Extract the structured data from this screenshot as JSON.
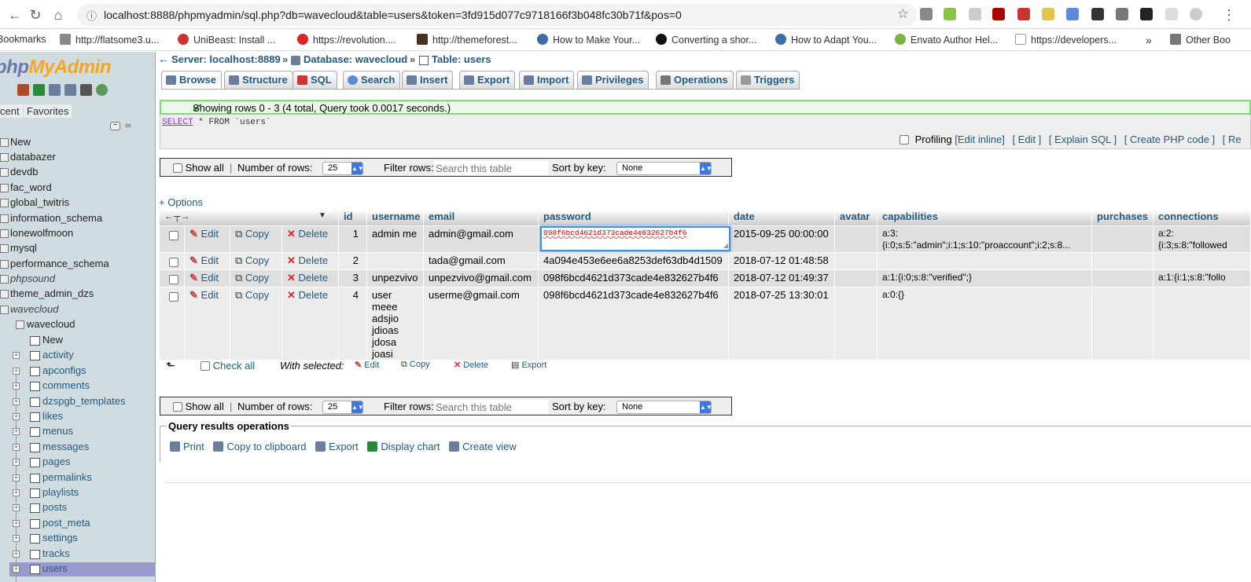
{
  "browser": {
    "url": "localhost:8888/phpmyadmin/sql.php?db=wavecloud&table=users&token=3fd915d077c9718166f3b048fc30b71f&pos=0",
    "bookmarks": [
      "Bookmarks",
      "http://flatsome3.u...",
      "UniBeast: Install ...",
      "https://revolution....",
      "http://themeforest...",
      "How to Make Your...",
      "Converting a shor...",
      "How to Adapt You...",
      "Envato Author Hel...",
      "https://developers...",
      "Other Boo"
    ],
    "more": "»"
  },
  "sidebar": {
    "logo_a": "php",
    "logo_b": "MyAdmin",
    "tab_recent": "cent",
    "tab_favorites": "Favorites",
    "databases": [
      {
        "name": "New",
        "italic": false
      },
      {
        "name": "databazer",
        "italic": false
      },
      {
        "name": "devdb",
        "italic": false
      },
      {
        "name": "fac_word",
        "italic": false
      },
      {
        "name": "global_twitris",
        "italic": false
      },
      {
        "name": "information_schema",
        "italic": false
      },
      {
        "name": "lonewolfmoon",
        "italic": false
      },
      {
        "name": "mysql",
        "italic": false
      },
      {
        "name": "performance_schema",
        "italic": false
      },
      {
        "name": "phpsound",
        "italic": true
      },
      {
        "name": "theme_admin_dzs",
        "italic": false
      },
      {
        "name": "wavecloud",
        "italic": true
      },
      {
        "name": "wavecloud",
        "italic": false
      }
    ],
    "tables": [
      "New",
      "activity",
      "apconfigs",
      "comments",
      "dzspgb_templates",
      "likes",
      "menus",
      "messages",
      "pages",
      "permalinks",
      "playlists",
      "posts",
      "post_meta",
      "settings",
      "tracks",
      "users"
    ]
  },
  "breadcrumb": {
    "server": "Server: localhost:8889",
    "database": "Database: wavecloud",
    "table": "Table: users",
    "sep": "»"
  },
  "tabs": [
    "Browse",
    "Structure",
    "SQL",
    "Search",
    "Insert",
    "Export",
    "Import",
    "Privileges",
    "Operations",
    "Triggers"
  ],
  "result": {
    "message": "Showing rows 0 - 3 (4 total, Query took 0.0017 seconds.)",
    "sql_select": "SELECT",
    "sql_rest": " * FROM `users`",
    "profiling": "Profiling",
    "links": [
      "[Edit inline]",
      "[ Edit ]",
      "[ Explain SQL ]",
      "[ Create PHP code ]",
      "[ Re"
    ]
  },
  "navbar": {
    "show_all": "Show all",
    "sep": "|",
    "num_rows_label": "Number of rows:",
    "num_rows_value": "25",
    "filter_label": "Filter rows:",
    "filter_placeholder": "Search this table",
    "sort_label": "Sort by key:",
    "sort_value": "None"
  },
  "options_link": "+ Options",
  "table": {
    "columns": [
      "id",
      "username",
      "email",
      "password",
      "date",
      "avatar",
      "capabilities",
      "purchases",
      "connections"
    ],
    "action_labels": {
      "edit": "Edit",
      "copy": "Copy",
      "delete": "Delete"
    },
    "rows": [
      {
        "id": "1",
        "username": "admin me",
        "email": "admin@gmail.com",
        "password": "098f6bcd4621d373cade4e832627b4f6",
        "date": "2015-09-25 00:00:00",
        "avatar": "",
        "capabilities": "a:3:\n{i:0;s:5:\"admin\";i:1;s:10:\"proaccount\";i:2;s:8...",
        "purchases": "",
        "connections": "a:2:\n{i:3;s:8:\"followed"
      },
      {
        "id": "2",
        "username": "",
        "email": "tada@gmail.com",
        "password": "4a094e453e6ee6a8253def63db4d1509",
        "date": "2018-07-12 01:48:58",
        "avatar": "",
        "capabilities": "",
        "purchases": "",
        "connections": ""
      },
      {
        "id": "3",
        "username": "unpezvivo",
        "email": "unpezvivo@gmail.com",
        "password": "098f6bcd4621d373cade4e832627b4f6",
        "date": "2018-07-12 01:49:37",
        "avatar": "",
        "capabilities": "a:1:{i:0;s:8:\"verified\";}",
        "purchases": "",
        "connections": "a:1:{i:1;s:8:\"follo"
      },
      {
        "id": "4",
        "username": "user meee\nadsjio\njdioas\njdosa joasi\njasoi\njiasdo j...",
        "email": "userme@gmail.com",
        "password": "098f6bcd4621d373cade4e832627b4f6",
        "date": "2018-07-25 13:30:01",
        "avatar": "",
        "capabilities": "a:0:{}",
        "purchases": "",
        "connections": ""
      }
    ],
    "inline_edit_value": "098f6bcd4621d373cade4e832627b4f6"
  },
  "with_selected": {
    "check_all": "Check all",
    "label": "With selected:",
    "edit": "Edit",
    "copy": "Copy",
    "delete": "Delete",
    "export": "Export"
  },
  "query_ops": {
    "legend": "Query results operations",
    "links": [
      "Print",
      "Copy to clipboard",
      "Export",
      "Display chart",
      "Create view"
    ]
  }
}
